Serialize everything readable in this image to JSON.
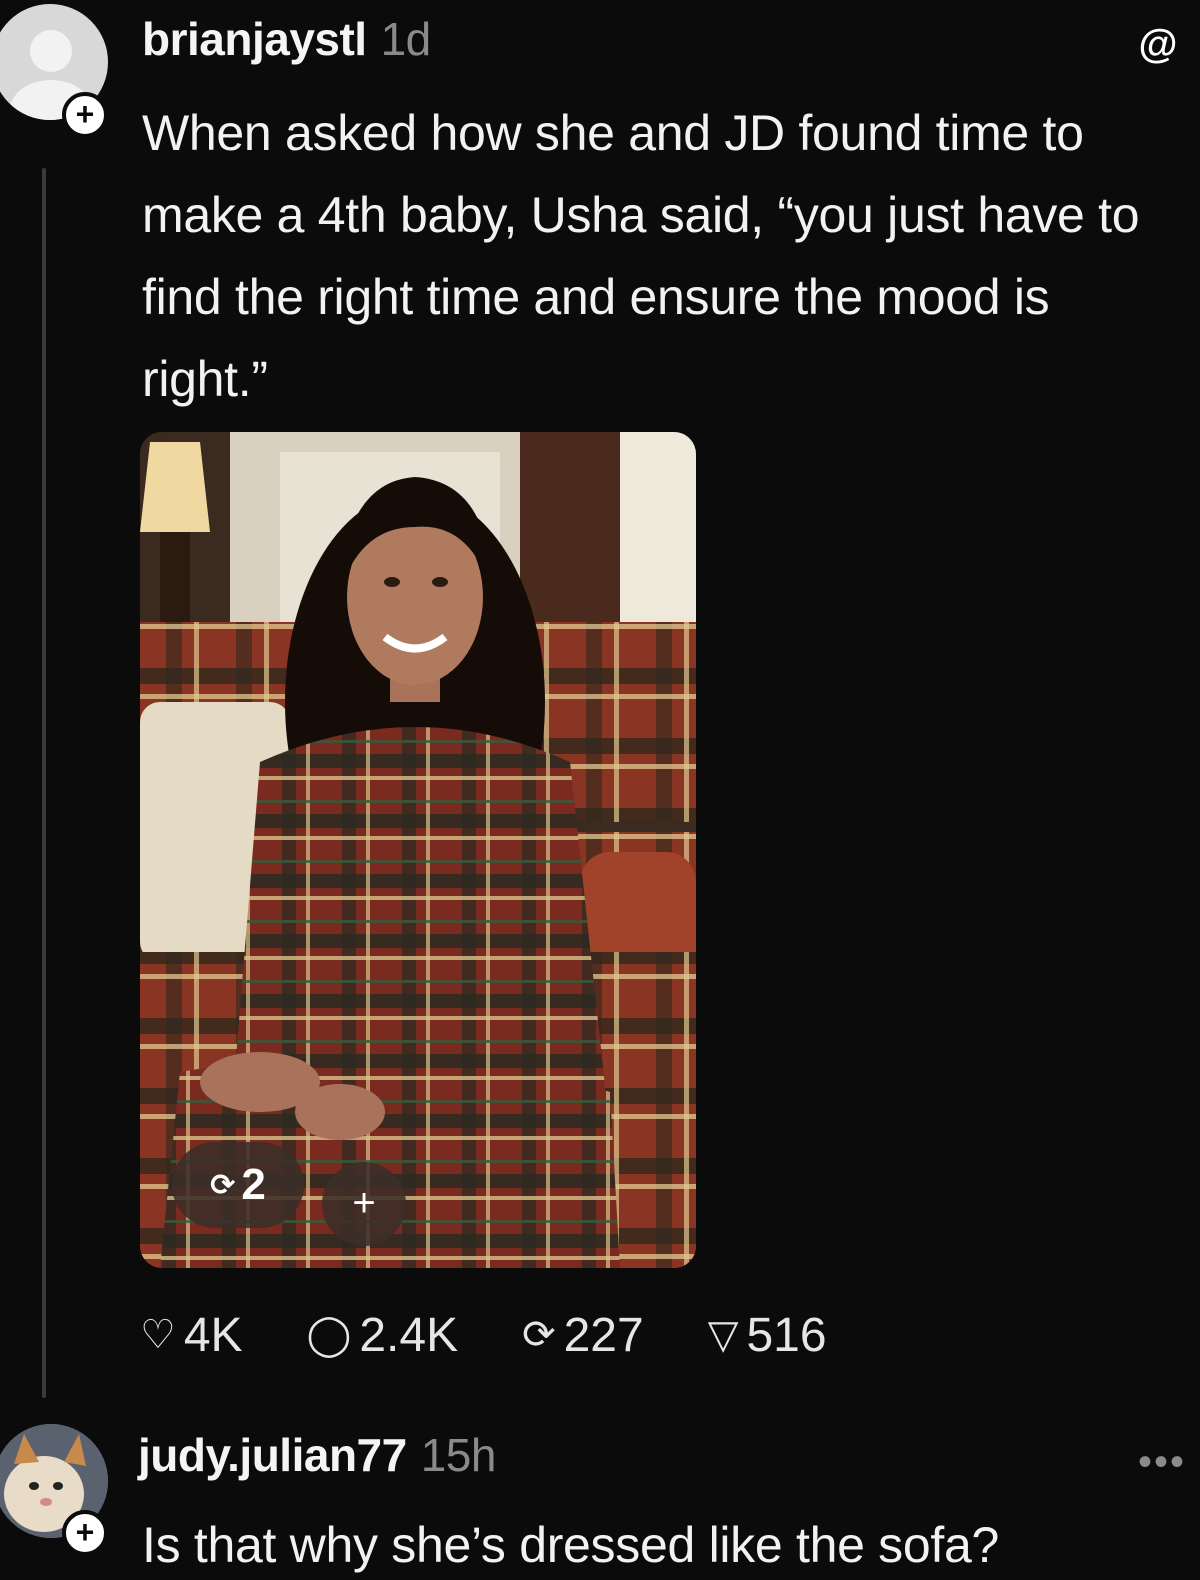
{
  "post": {
    "username": "brianjaystl",
    "timestamp": "1d",
    "text": "When asked how she and JD found time to make a 4th baby, Usha said, “you just have to find the right time and ensure the mood is right.”",
    "follow_glyph": "+",
    "image": {
      "repost_count": "2",
      "add_glyph": "+"
    },
    "actions": {
      "likes": "4K",
      "comments": "2.4K",
      "reposts": "227",
      "shares": "516"
    }
  },
  "reply": {
    "username": "judy.julian77",
    "timestamp": "15h",
    "text": "Is that why she’s dressed like the sofa?",
    "follow_glyph": "+",
    "more_glyph": "•••"
  },
  "app": {
    "logo_glyph": "@"
  },
  "colors": {
    "background": "#0b0b0b",
    "text": "#f2f2f2",
    "muted": "#8a8a8a"
  }
}
